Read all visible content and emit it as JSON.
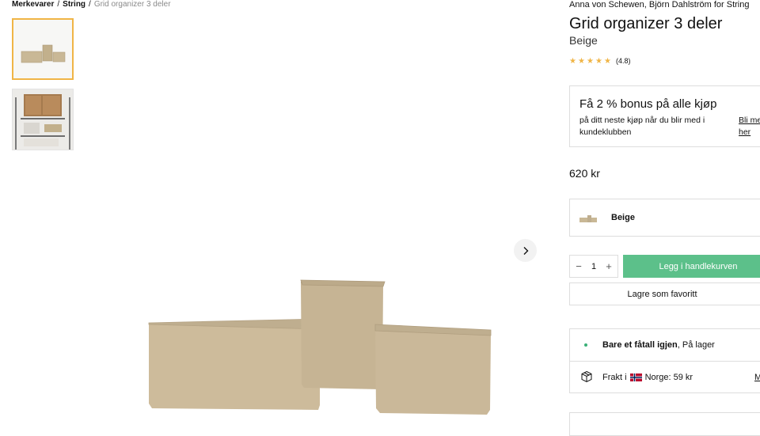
{
  "breadcrumb": {
    "items": [
      "Merkevarer",
      "String"
    ],
    "separator": "/",
    "current": "Grid organizer 3 deler"
  },
  "gallery": {
    "thumbnails": [
      "grid-organizer-product",
      "grid-organizer-on-shelf"
    ],
    "active_index": 0
  },
  "product": {
    "designers": "Anna von Schewen, Björn Dahlström",
    "designers_for": "for",
    "brand": "String",
    "title": "Grid organizer 3 deler",
    "variant": "Beige",
    "rating_stars": 5,
    "rating_text": "(4.8)",
    "price": "620 kr"
  },
  "bonus": {
    "title": "Få 2 % bonus på alle kjøp",
    "description": "på ditt neste kjøp når du blir med i kundeklubben",
    "link": "Bli me her"
  },
  "color_select": {
    "label": "Beige"
  },
  "quantity": {
    "value": "1",
    "minus": "−",
    "plus": "+"
  },
  "actions": {
    "add_to_cart": "Legg i handlekurven",
    "favorite": "Lagre som favoritt"
  },
  "stock": {
    "strong": "Bare et fåtall igjen",
    "rest": ", På lager"
  },
  "shipping": {
    "prefix": "Frakt i",
    "country_price": "Norge: 59 kr",
    "more": "M"
  },
  "colors": {
    "accent_green": "#5cc08a",
    "star": "#f0b546",
    "stock_dot": "#3ab078",
    "active_thumb_border": "#f0b546"
  },
  "icons": [
    "chevron-right-icon",
    "star-icon",
    "package-icon",
    "norway-flag-icon"
  ]
}
